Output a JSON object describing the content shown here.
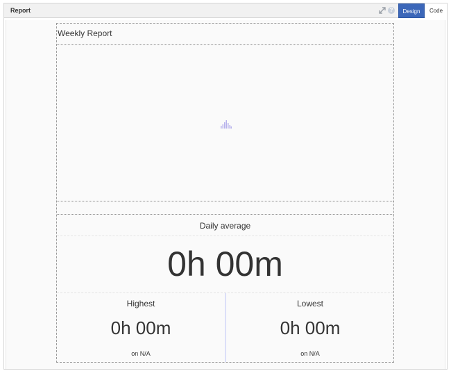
{
  "panel": {
    "title": "Report",
    "tabs": [
      "Design",
      "Code"
    ],
    "active_tab": "Design",
    "help_glyph": "?",
    "accent_color": "#3c67b9"
  },
  "report": {
    "title": "Weekly Report",
    "daily_average": {
      "label": "Daily average",
      "value": "0h 00m"
    },
    "highest": {
      "label": "Highest",
      "value": "0h 00m",
      "sub": "on N/A"
    },
    "lowest": {
      "label": "Lowest",
      "value": "0h 00m",
      "sub": "on N/A"
    }
  },
  "icons": {
    "expand": "expand-icon",
    "help": "help-icon",
    "chart_loading": "bar-chart-icon"
  }
}
